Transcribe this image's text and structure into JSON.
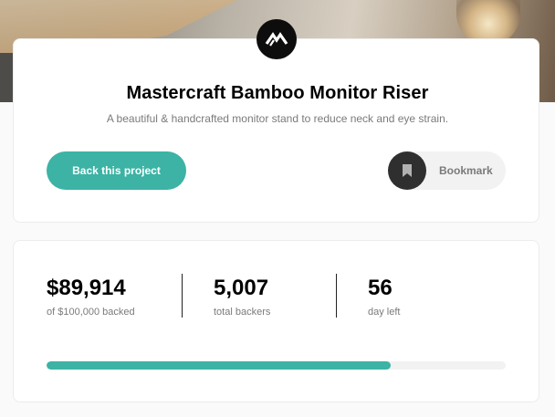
{
  "project": {
    "title": "Mastercraft Bamboo Monitor Riser",
    "description": "A beautiful & handcrafted monitor stand to reduce neck and eye strain."
  },
  "actions": {
    "back_label": "Back this project",
    "bookmark_label": "Bookmark"
  },
  "stats": [
    {
      "value": "$89,914",
      "label": "of $100,000 backed"
    },
    {
      "value": "5,007",
      "label": "total backers"
    },
    {
      "value": "56",
      "label": "day left"
    }
  ],
  "progress": {
    "fraction": 0.75
  },
  "colors": {
    "accent": "#3cb3a4",
    "dark": "#2f2f2f",
    "muted_text": "#7a7a7a",
    "track": "#f2f2f2"
  },
  "icons": {
    "logo": "mastercraft-logo-icon",
    "bookmark": "bookmark-icon"
  }
}
